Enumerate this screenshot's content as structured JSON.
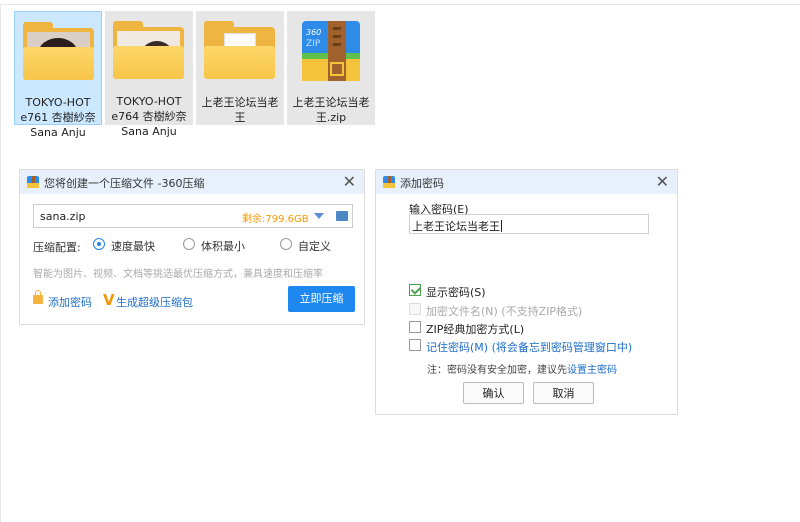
{
  "files": [
    {
      "name_lines": [
        "TOKYO-HOT",
        "e761 杏樹紗奈",
        "Sana Anju"
      ],
      "type": "photo-folder",
      "selected": true
    },
    {
      "name_lines": [
        "TOKYO-HOT",
        "e764 杏樹紗奈",
        "Sana Anju"
      ],
      "type": "photo-folder",
      "selected": false
    },
    {
      "name_lines": [
        "上老王论坛当老",
        "王"
      ],
      "type": "document-folder",
      "selected": false
    },
    {
      "name_lines": [
        "上老王论坛当老",
        "王.zip"
      ],
      "type": "zip-archive",
      "selected": false
    }
  ],
  "compress_dialog": {
    "title": "您将创建一个压缩文件 -360压缩",
    "close_label": "✕",
    "path_value": "sana.zip",
    "free_space": "剩余:799.6GB",
    "config_label": "压缩配置:",
    "options": [
      {
        "label": "速度最快",
        "checked": true
      },
      {
        "label": "体积最小",
        "checked": false
      },
      {
        "label": "自定义",
        "checked": false
      }
    ],
    "hint": "智能为图片、视频、文档等挑选最优压缩方式，兼具速度和压缩率",
    "add_password_link": "添加密码",
    "super_package_link": "生成超级压缩包",
    "compress_button": "立即压缩"
  },
  "password_dialog": {
    "title": "添加密码",
    "close_label": "✕",
    "input_label": "输入密码(E)",
    "password_value": "上老王论坛当老王",
    "checkboxes": [
      {
        "label": "显示密码(S)",
        "checked": true,
        "disabled": false,
        "style": "normal"
      },
      {
        "label": "加密文件名(N) (不支持ZIP格式)",
        "checked": false,
        "disabled": true,
        "style": "disabled"
      },
      {
        "label": "ZIP经典加密方式(L)",
        "checked": false,
        "disabled": false,
        "style": "normal"
      },
      {
        "label": "记住密码(M) (将会备忘到密码管理窗口中)",
        "checked": false,
        "disabled": false,
        "style": "blue"
      }
    ],
    "note_prefix": "注：密码没有安全加密，建议先",
    "note_link": "设置主密码",
    "confirm_button": "确认",
    "cancel_button": "取消"
  },
  "colors": {
    "accent": "#1e87f0",
    "folder": "#f7c548",
    "free_space": "#f39800",
    "link": "#1e6ec8"
  }
}
